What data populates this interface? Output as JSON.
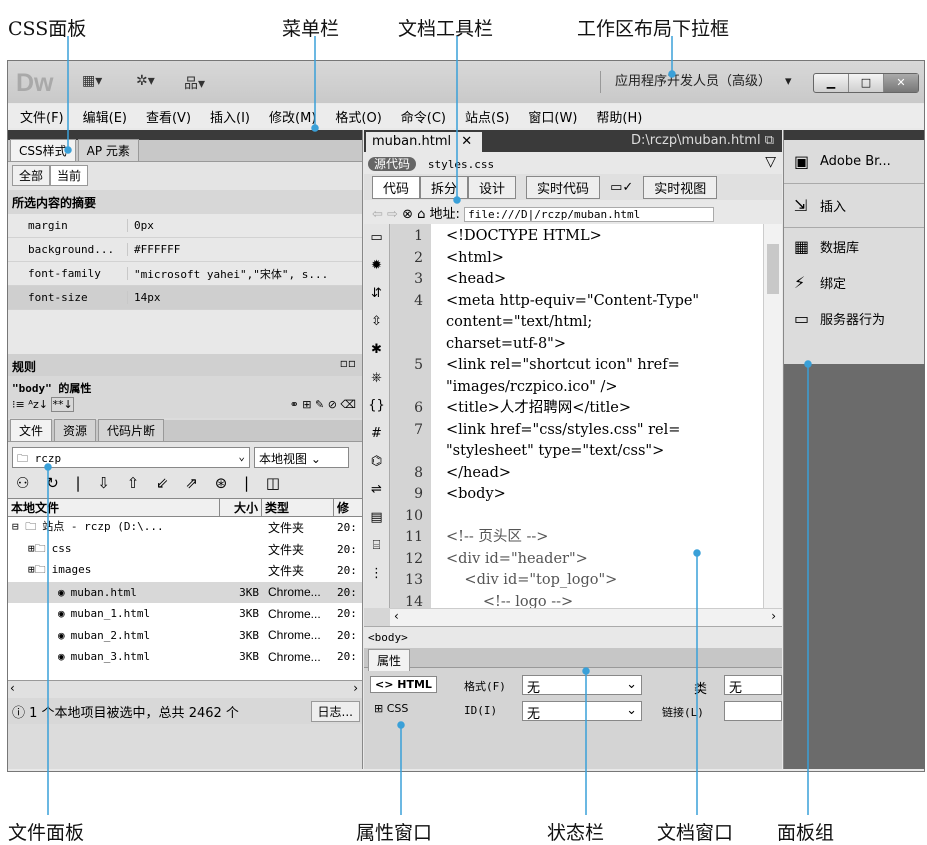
{
  "annotations": {
    "css_panel": "CSS面板",
    "menu_bar": "菜单栏",
    "doc_toolbar": "文档工具栏",
    "workspace_dropdown": "工作区布局下拉框",
    "file_panel": "文件面板",
    "property_window": "属性窗口",
    "status_bar": "状态栏",
    "doc_window": "文档窗口",
    "panel_group": "面板组"
  },
  "app": {
    "logo": "Dw",
    "workspace": "应用程序开发人员（高级）",
    "menu": [
      "文件(F)",
      "编辑(E)",
      "查看(V)",
      "插入(I)",
      "修改(M)",
      "格式(O)",
      "命令(C)",
      "站点(S)",
      "窗口(W)",
      "帮助(H)"
    ]
  },
  "css_panel": {
    "tabs": [
      "CSS样式",
      "AP 元素"
    ],
    "modes": [
      "全部",
      "当前"
    ],
    "summary_title": "所选内容的摘要",
    "props": [
      {
        "name": "margin",
        "value": "0px"
      },
      {
        "name": "background...",
        "value": "#FFFFFF"
      },
      {
        "name": "font-family",
        "value": "\"microsoft yahei\",\"宋体\", s..."
      },
      {
        "name": "font-size",
        "value": "14px"
      }
    ],
    "rules_title": "规则",
    "body_props": "\"body\" 的属性"
  },
  "files_panel": {
    "tabs": [
      "文件",
      "资源",
      "代码片断"
    ],
    "site": "rczp",
    "view": "本地视图",
    "columns": [
      "本地文件",
      "大小",
      "类型",
      "修"
    ],
    "rows": [
      {
        "name": "站点 - rczp (D:\\...",
        "size": "",
        "type": "文件夹",
        "mod": "20:"
      },
      {
        "name": "css",
        "size": "",
        "type": "文件夹",
        "mod": "20:"
      },
      {
        "name": "images",
        "size": "",
        "type": "文件夹",
        "mod": "20:"
      },
      {
        "name": "muban.html",
        "size": "3KB",
        "type": "Chrome...",
        "mod": "20:"
      },
      {
        "name": "muban_1.html",
        "size": "3KB",
        "type": "Chrome...",
        "mod": "20:"
      },
      {
        "name": "muban_2.html",
        "size": "3KB",
        "type": "Chrome...",
        "mod": "20:"
      },
      {
        "name": "muban_3.html",
        "size": "3KB",
        "type": "Chrome...",
        "mod": "20:"
      }
    ],
    "status": "1 个本地项目被选中，总共 2462 个",
    "log_btn": "日志..."
  },
  "document": {
    "tab": "muban.html",
    "path": "D:\\rczp\\muban.html",
    "source_label": "源代码",
    "related_file": "styles.css",
    "view_buttons": [
      "代码",
      "拆分",
      "设计",
      "实时代码",
      "实时视图"
    ],
    "address_label": "地址:",
    "address": "file:///D|/rczp/muban.html",
    "gutter": [
      "1",
      "2",
      "3",
      "4",
      "",
      "",
      "5",
      "",
      "6",
      "7",
      "",
      "8",
      "9",
      "10",
      "11",
      "12",
      "13",
      "14"
    ],
    "lines": [
      "<!DOCTYPE HTML>",
      "<html>",
      "<head>",
      "<meta http-equiv=\"Content-Type\"",
      "content=\"text/html;",
      "charset=utf-8\">",
      "<link rel=\"shortcut icon\" href=",
      "\"images/rczpico.ico\" />",
      "<title>人才招聘网</title>",
      "<link href=\"css/styles.css\" rel=",
      "\"stylesheet\" type=\"text/css\">",
      "</head>",
      "<body>",
      "",
      "<!-- 页头区 -->",
      "<div id=\"header\">",
      "    <div id=\"top_logo\">",
      "        <!-- logo -->"
    ],
    "status_tag": "<body>"
  },
  "properties": {
    "title": "属性",
    "html_btn": "HTML",
    "css_btn": "CSS",
    "format_label": "格式(F)",
    "format_value": "无",
    "id_label": "ID(I)",
    "id_value": "无",
    "class_label": "类",
    "class_value": "无",
    "link_label": "链接(L)"
  },
  "panel_group": {
    "items": [
      "Adobe Br...",
      "插入",
      "数据库",
      "绑定",
      "服务器行为"
    ]
  }
}
